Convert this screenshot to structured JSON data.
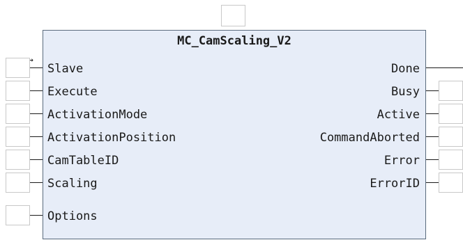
{
  "block": {
    "title": "MC_CamScaling_V2"
  },
  "inputs": [
    {
      "name": "Slave",
      "inout": true
    },
    {
      "name": "Execute"
    },
    {
      "name": "ActivationMode"
    },
    {
      "name": "ActivationPosition"
    },
    {
      "name": "CamTableID"
    },
    {
      "name": "Scaling"
    },
    {
      "name": "Options"
    }
  ],
  "outputs": [
    {
      "name": "Done",
      "connected": true
    },
    {
      "name": "Busy"
    },
    {
      "name": "Active"
    },
    {
      "name": "CommandAborted"
    },
    {
      "name": "Error"
    },
    {
      "name": "ErrorID"
    }
  ],
  "icons": {
    "inout": "↔"
  },
  "colors": {
    "block_fill": "#e7edf8",
    "block_border": "#5a6b7d",
    "placeholder_border": "#c8c8c8"
  }
}
